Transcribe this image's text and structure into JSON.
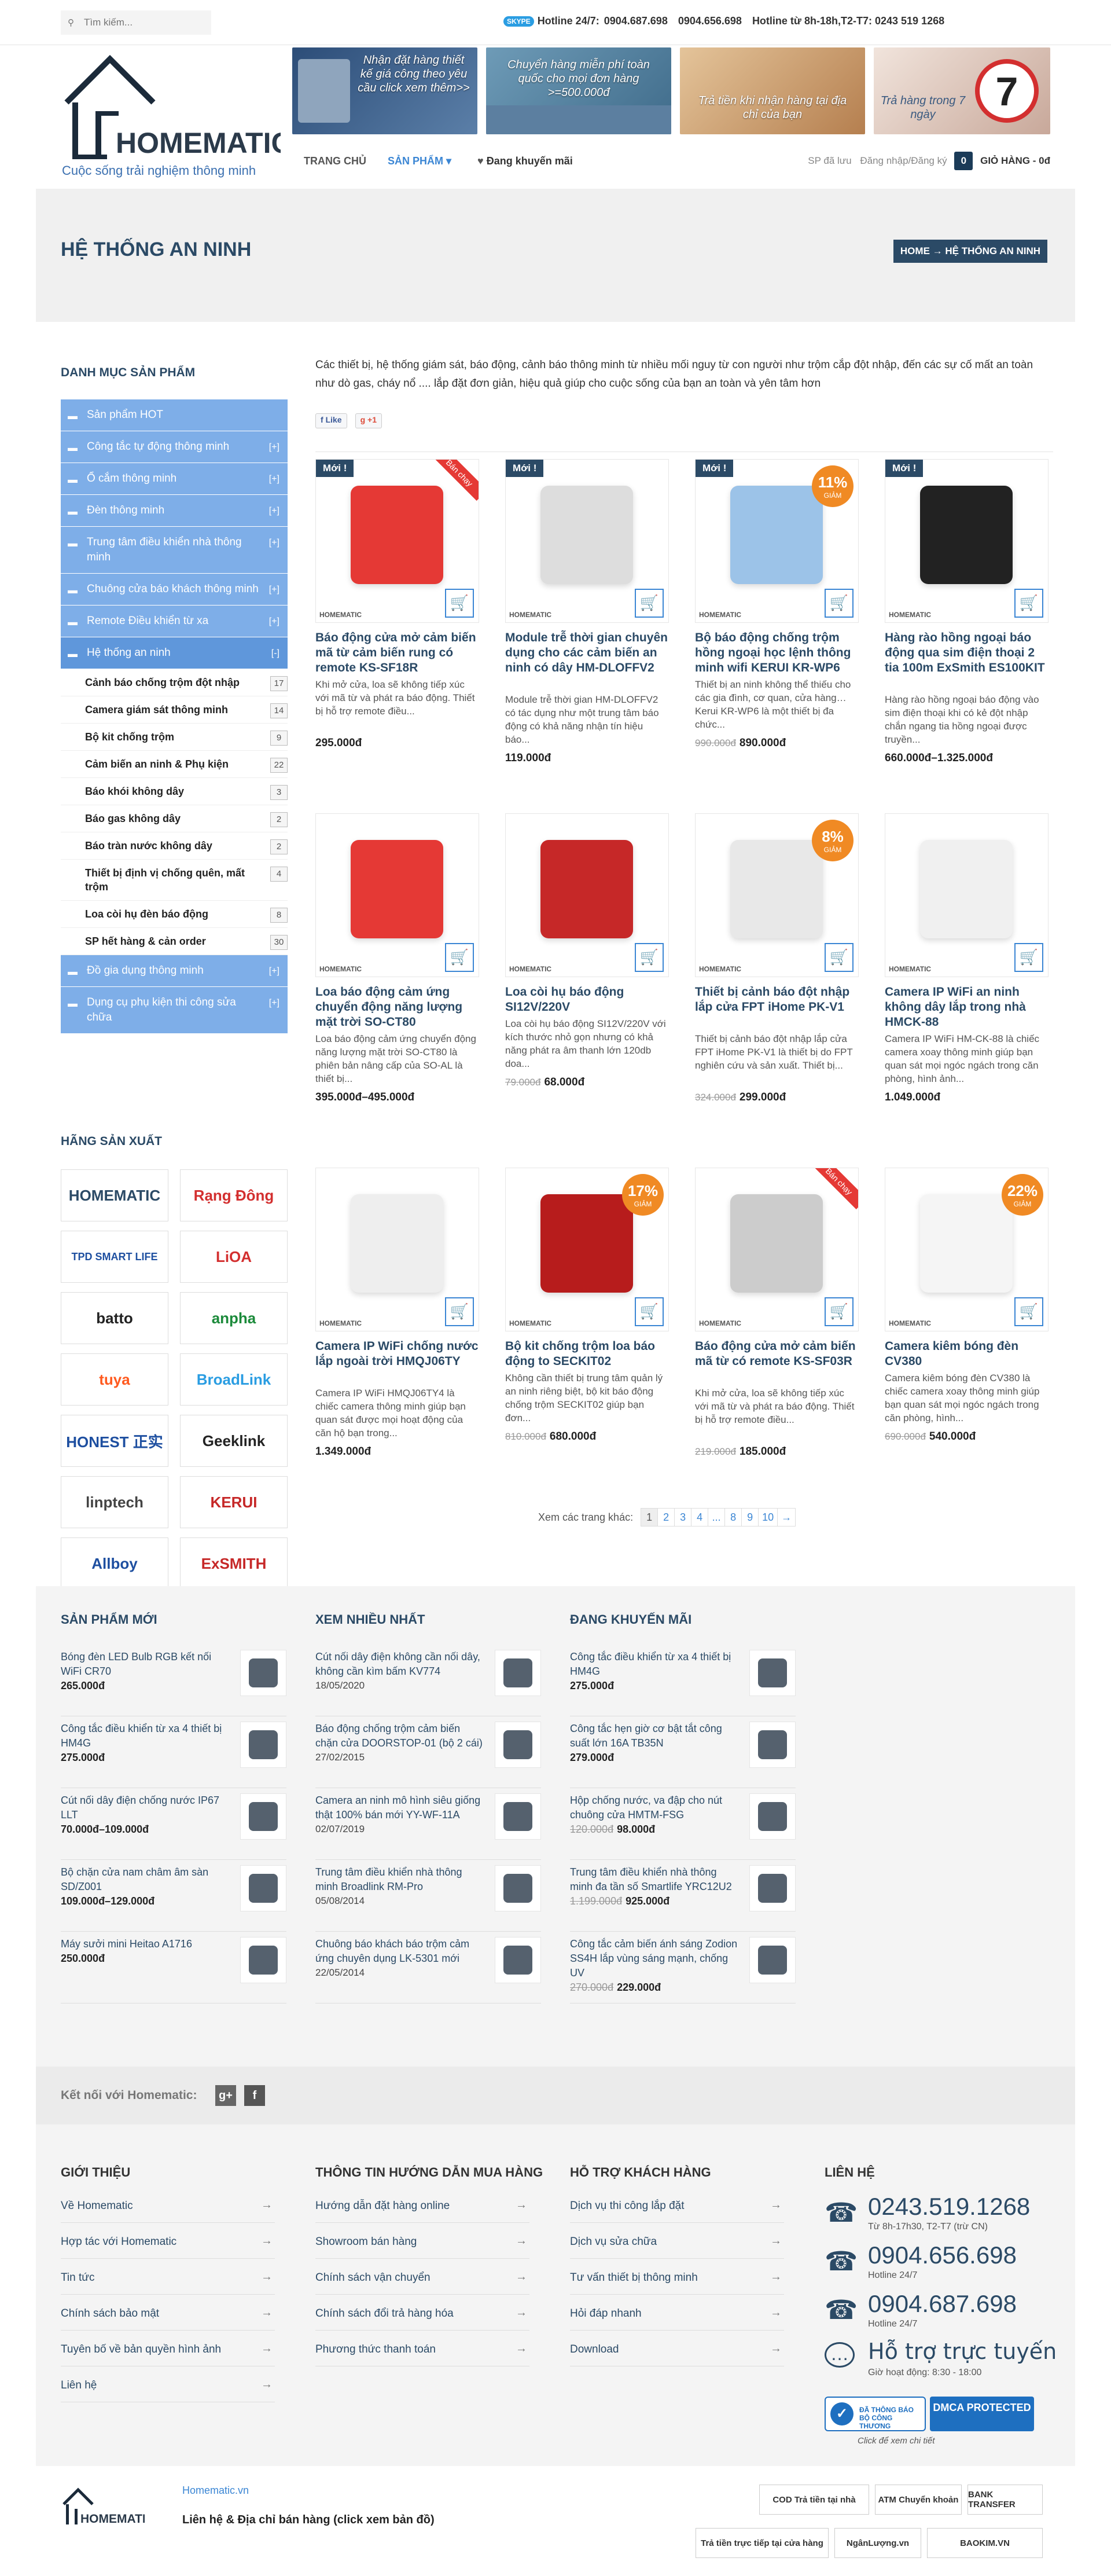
{
  "topbar": {
    "search_placeholder": "Tìm kiếm...",
    "skype": "SKYPE",
    "hotline_label": "Hotline 24/7:",
    "hotline_1": "0904.687.698",
    "hotline_2": "0904.656.698",
    "hotline_office": "Hotline từ 8h-18h,T2-T7: 0243 519 1268"
  },
  "logo": {
    "name": "HOMEMATIC",
    "tagline": "Cuộc sống trải nghiệm thông minh"
  },
  "banners": [
    {
      "text": "Nhận đặt hàng thiết kế giá công theo yêu cầu click xem thêm>>",
      "color": "#3b5e8a"
    },
    {
      "text": "Chuyển hàng miễn phí toàn quốc cho mọi đơn hàng >=500.000đ",
      "color": "#5a8aa8"
    },
    {
      "text": "Trả tiền khi nhận hàng tại địa chỉ của bạn",
      "color": "#c79a6a"
    },
    {
      "text": "Trả hàng trong 7 ngày",
      "color": "#d0b8a8"
    }
  ],
  "nav": {
    "home": "TRANG CHỦ",
    "products": "SẢN PHẨM",
    "promo": "Đang khuyến mãi",
    "saved": "SP đã lưu",
    "account": "Đăng nhập/Đăng ký",
    "cart_count": "0",
    "cart_label": "GIỎ HÀNG - 0đ"
  },
  "page": {
    "title": "HỆ THỐNG AN NINH",
    "breadcrumb": "HOME → HỆ THỐNG AN NINH"
  },
  "sidebar": {
    "cat_title": "DANH MỤC SẢN PHẨM",
    "categories": [
      {
        "label": "Sản phẩm HOT",
        "toggle": ""
      },
      {
        "label": "Công tắc tự động thông minh",
        "toggle": "[+]"
      },
      {
        "label": "Ổ cắm thông minh",
        "toggle": "[+]"
      },
      {
        "label": "Đèn thông minh",
        "toggle": "[+]"
      },
      {
        "label": "Trung tâm điều khiển nhà thông minh",
        "toggle": "[+]"
      },
      {
        "label": "Chuông cửa báo khách thông minh",
        "toggle": "[+]"
      },
      {
        "label": "Remote Điều khiển từ xa",
        "toggle": "[+]"
      },
      {
        "label": "Hệ thống an ninh",
        "toggle": "[-]"
      }
    ],
    "subcats": [
      {
        "label": "Cảnh báo chống trộm đột nhập",
        "count": "17"
      },
      {
        "label": "Camera giám sát thông minh",
        "count": "14"
      },
      {
        "label": "Bộ kit chống trộm",
        "count": "9"
      },
      {
        "label": "Cảm biến an ninh & Phụ kiện",
        "count": "22"
      },
      {
        "label": "Báo khói không dây",
        "count": "3"
      },
      {
        "label": "Báo gas không dây",
        "count": "2"
      },
      {
        "label": "Báo tràn nước không dây",
        "count": "2"
      },
      {
        "label": "Thiết bị định vị chống quên, mất trộm",
        "count": "4"
      },
      {
        "label": "Loa còi hụ đèn báo động",
        "count": "8"
      },
      {
        "label": "SP hết hàng & cản order",
        "count": "30"
      }
    ],
    "categories2": [
      {
        "label": "Đồ gia dụng thông minh",
        "toggle": "[+]"
      },
      {
        "label": "Dụng cụ phụ kiện thi công sửa chữa",
        "toggle": "[+]"
      }
    ],
    "brand_title": "HÃNG SẢN XUẤT",
    "brands": [
      {
        "name": "HOMEMATIC",
        "color": "#2b4a66"
      },
      {
        "name": "Rạng Đông",
        "color": "#d32f2f"
      },
      {
        "name": "TPD SMART LIFE",
        "color": "#1e4fa0"
      },
      {
        "name": "LiOA",
        "color": "#d32f2f"
      },
      {
        "name": "batto",
        "color": "#222"
      },
      {
        "name": "anpha",
        "color": "#1b8a3a"
      },
      {
        "name": "tuya",
        "color": "#ff5a1f"
      },
      {
        "name": "BroadLink",
        "color": "#2a9de2"
      },
      {
        "name": "HONEST 正实",
        "color": "#1e4fa0"
      },
      {
        "name": "Geeklink",
        "color": "#222"
      },
      {
        "name": "linptech",
        "color": "#444"
      },
      {
        "name": "KERUI",
        "color": "#c62828"
      },
      {
        "name": "Allboy",
        "color": "#1e4fa0"
      },
      {
        "name": "ExSMITH",
        "color": "#c62828"
      }
    ]
  },
  "main": {
    "intro": "Các thiết bị, hệ thống giám sát, báo động, cảnh báo thông minh từ nhiều mối nguy từ con người như trộm cắp đột nhập, đến các sự cố mất an toàn như dò gas, cháy nổ .... lắp đặt đơn giản, hiệu quả giúp cho cuộc sống của bạn an toàn và yên tâm hơn",
    "like": "Like",
    "gplus": "+1",
    "products": [
      {
        "name": "Báo động cửa mở cảm biến mã từ cảm biến rung có remote KS-SF18R",
        "desc": "Khi mở cửa, loa sẽ không tiếp xúc với mã từ và phát ra báo động. Thiết bị hỗ trợ remote điều...",
        "old": "",
        "price": "295.000đ",
        "new": "Mới !",
        "pct": "",
        "hot": "Bán chạy",
        "img": "#e53935"
      },
      {
        "name": "Module trễ thời gian chuyên dụng cho các cảm biến an ninh có dây HM-DLOFFV2",
        "desc": "Module trễ thời gian HM-DLOFFV2 có tác dụng như một trung tâm báo động có khả năng nhận tín hiệu báo...",
        "old": "",
        "price": "119.000đ",
        "new": "Mới !",
        "pct": "",
        "hot": "",
        "img": "#ddd"
      },
      {
        "name": "Bộ báo động chống trộm hồng ngoại học lệnh thông minh wifi KERUI KR-WP6",
        "desc": "Thiết bị an ninh không thể thiếu cho các gia đình, cơ quan, cửa hàng…Kerui KR-WP6 là một thiết bị đa chức...",
        "old": "990.000đ",
        "price": "890.000đ",
        "new": "Mới !",
        "pct": "11%",
        "hot": "",
        "img": "#9cc3e8"
      },
      {
        "name": "Hàng rào hồng ngoại báo động qua sim điện thoại 2 tia 100m ExSmith ES100KIT",
        "desc": "Hàng rào hồng ngoại báo động vào sim điện thoại khi có kẻ đột nhập chắn ngang tia hồng ngoại được truyền...",
        "old": "",
        "price": "660.000đ–1.325.000đ",
        "new": "Mới !",
        "pct": "",
        "hot": "",
        "img": "#222"
      },
      {
        "name": "Loa báo động cảm ứng chuyển động năng lượng mặt trời SO-CT80",
        "desc": "Loa báo động cảm ứng chuyển động năng lượng mặt trời SO-CT80 là phiên bản nâng cấp của SO-AL là thiết bị...",
        "old": "",
        "price": "395.000đ–495.000đ",
        "new": "",
        "pct": "",
        "hot": "",
        "img": "#e53935"
      },
      {
        "name": "Loa còi hụ báo động SI12V/220V",
        "desc": "Loa còi hụ báo động SI12V/220V với kích thước nhỏ gọn nhưng có khả năng phát ra âm thanh lớn 120db doa...",
        "old": "79.000đ",
        "price": "68.000đ",
        "new": "",
        "pct": "",
        "hot": "",
        "img": "#c62828"
      },
      {
        "name": "Thiết bị cảnh báo đột nhập lắp cửa FPT iHome PK-V1",
        "desc": "Thiết bị cảnh báo đột nhập lắp cửa FPT iHome PK-V1 là thiết bị do FPT nghiên cứu và sản xuất. Thiết bị...",
        "old": "324.000đ",
        "price": "299.000đ",
        "new": "",
        "pct": "8%",
        "hot": "",
        "img": "#e8e8e8"
      },
      {
        "name": "Camera IP WiFi an ninh không dây lắp trong nhà HMCK-88",
        "desc": "Camera IP WiFi HM-CK-88 là chiếc camera xoay thông minh giúp bạn quan sát mọi ngóc ngách trong căn phòng, hình ảnh...",
        "old": "",
        "price": "1.049.000đ",
        "new": "",
        "pct": "",
        "hot": "",
        "img": "#f0f0f0"
      },
      {
        "name": "Camera IP WiFi chống nước lắp ngoài trời HMQJ06TY",
        "desc": "Camera IP WiFi HMQJ06TY4 là chiếc camera thông minh giúp bạn quan sát được mọi hoạt động của căn hộ bạn trong...",
        "old": "",
        "price": "1.349.000đ",
        "new": "",
        "pct": "",
        "hot": "",
        "img": "#eee"
      },
      {
        "name": "Bộ kit chống trộm loa báo động to SECKIT02",
        "desc": "Không cần thiết bị trung tâm quản lý an ninh riêng biệt, bộ kit báo động chống trộm SECKIT02 giúp bạn đơn...",
        "old": "810.000đ",
        "price": "680.000đ",
        "new": "",
        "pct": "17%",
        "hot": "",
        "img": "#b71c1c"
      },
      {
        "name": "Báo động cửa mở cảm biến mã từ có remote KS-SF03R",
        "desc": "Khi mở cửa, loa sẽ không tiếp xúc với mã từ và phát ra báo động. Thiết bị hỗ trợ remote điều...",
        "old": "219.000đ",
        "price": "185.000đ",
        "new": "",
        "pct": "",
        "hot": "Bán chạy",
        "img": "#ccc"
      },
      {
        "name": "Camera kiêm bóng đèn CV380",
        "desc": "Camera kiêm bóng đèn CV380 là chiếc camera xoay thông minh giúp bạn quan sát mọi ngóc ngách trong căn phòng, hình...",
        "old": "690.000đ",
        "price": "540.000đ",
        "new": "",
        "pct": "22%",
        "hot": "",
        "img": "#f5f5f5"
      }
    ],
    "discount_word": "GIẢM",
    "watermark": "HOMEMATIC",
    "pager_label": "Xem các trang khác:",
    "pages": [
      "1",
      "2",
      "3",
      "4",
      "...",
      "8",
      "9",
      "10",
      "→"
    ]
  },
  "lower": {
    "new_title": "SẢN PHẨM MỚI",
    "new_items": [
      {
        "name": "Bóng đèn LED Bulb RGB kết nối WiFi CR70",
        "price": "265.000đ",
        "old": ""
      },
      {
        "name": "Công tắc điều khiển từ xa 4 thiết bị HM4G",
        "price": "275.000đ",
        "old": ""
      },
      {
        "name": "Cút nối dây điện chống nước IP67 LLT",
        "price": "70.000đ–109.000đ",
        "old": ""
      },
      {
        "name": "Bộ chặn cửa nam châm âm sàn SD/Z001",
        "price": "109.000đ–129.000đ",
        "old": ""
      },
      {
        "name": "Máy sưởi mini Heitao A1716",
        "price": "250.000đ",
        "old": ""
      }
    ],
    "viewed_title": "XEM NHIỀU NHẤT",
    "viewed_items": [
      {
        "name": "Cút nối dây điện không cần nối dây, không cần kìm bấm KV774",
        "date": "18/05/2020"
      },
      {
        "name": "Báo động chống trộm cảm biến chặn cửa DOORSTOP-01 (bộ 2 cái)",
        "date": "27/02/2015"
      },
      {
        "name": "Camera an ninh mô hình siêu giống thật 100% bán mới YY-WF-11A",
        "date": "02/07/2019"
      },
      {
        "name": "Trung tâm điều khiển nhà thông minh Broadlink RM-Pro",
        "date": "05/08/2014"
      },
      {
        "name": "Chuông báo khách báo trộm cảm ứng chuyên dụng LK-5301 mới",
        "date": "22/05/2014"
      }
    ],
    "promo_title": "ĐANG KHUYẾN MÃI",
    "promo_items": [
      {
        "name": "Công tắc điều khiển từ xa 4 thiết bị HM4G",
        "price": "275.000đ",
        "old": ""
      },
      {
        "name": "Công tắc hẹn giờ cơ bật tắt công suất lớn 16A TB35N",
        "price": "279.000đ",
        "old": ""
      },
      {
        "name": "Hộp chống nước, va đập cho nút chuông cửa HMTM-FSG",
        "price": "98.000đ",
        "old": "120.000đ"
      },
      {
        "name": "Trung tâm điều khiển nhà thông minh đa tần số Smartlife YRC12U2",
        "price": "925.000đ",
        "old": "1.199.000đ"
      },
      {
        "name": "Công tắc cảm biến ánh sáng Zodion SS4H lắp vùng sáng mạnh, chống UV",
        "price": "229.000đ",
        "old": "270.000đ"
      }
    ]
  },
  "connect": {
    "label": "Kết nối với Homematic:",
    "g": "g+",
    "f": "f"
  },
  "footer": {
    "about_title": "GIỚI THIỆU",
    "about": [
      "Về Homematic",
      "Hợp tác với Homematic",
      "Tin tức",
      "Chính sách bảo mật",
      "Tuyên bố về bản quyền hình ảnh",
      "Liên hệ"
    ],
    "guide_title": "THÔNG TIN HƯỚNG DẪN MUA HÀNG",
    "guide": [
      "Hướng dẫn đặt hàng online",
      "Showroom bán hàng",
      "Chính sách vận chuyển",
      "Chính sách đổi trả hàng hóa",
      "Phương thức thanh toán"
    ],
    "support_title": "HỖ TRỢ KHÁCH HÀNG",
    "support": [
      "Dịch vụ thi công lắp đặt",
      "Dịch vụ sửa chữa",
      "Tư vấn thiết bị thông minh",
      "Hỏi đáp nhanh",
      "Download"
    ],
    "contact_title": "LIÊN HỆ",
    "phones": [
      {
        "num": "0243.519.1268",
        "sub": "Từ 8h-17h30, T2-T7 (trừ CN)"
      },
      {
        "num": "0904.656.698",
        "sub": "Hotline 24/7"
      },
      {
        "num": "0904.687.698",
        "sub": "Hotline 24/7"
      }
    ],
    "online": "Hỗ trợ trực tuyến",
    "hours": "Giờ hoạt động: 8:30 - 18:00",
    "bct": "ĐÃ THÔNG BÁO BỘ CÔNG THƯƠNG",
    "dmca": "DMCA PROTECTED",
    "click": "Click để xem chi tiết",
    "site": "Homematic.vn",
    "address": "Liên hệ & Địa chỉ bán hàng (click xem bản đồ)",
    "pay": [
      "COD Trả tiền tại nhà",
      "ATM Chuyển khoản",
      "BANK TRANSFER",
      "Trả tiền trực tiếp tại cửa hàng",
      "NgânLượng.vn",
      "BAOKIM.VN"
    ]
  }
}
